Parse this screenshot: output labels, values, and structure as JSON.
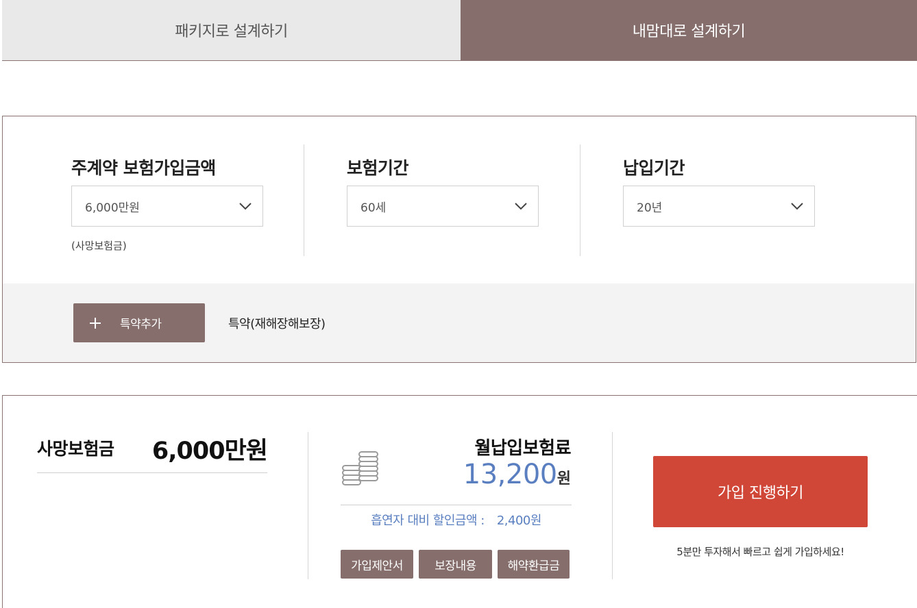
{
  "tabs": [
    {
      "label": "패키지로 설계하기",
      "active": false
    },
    {
      "label": "내맘대로 설계하기",
      "active": true
    }
  ],
  "options": [
    {
      "title": "주계약 보험가입금액",
      "selected": "6,000만원",
      "hint": "(사망보험금)"
    },
    {
      "title": "보험기간",
      "selected": "60세",
      "hint": ""
    },
    {
      "title": "납입기간",
      "selected": "20년",
      "hint": ""
    }
  ],
  "rider": {
    "add_button_label": "특약추가",
    "added_rider": "특약(재해장해보장)"
  },
  "summary": {
    "death_benefit_label": "사망보험금",
    "death_benefit_value": "6,000만원",
    "premium_label": "월납입보험료",
    "premium_value": "13,200",
    "premium_unit": "원",
    "discount_label": "흡연자 대비 할인금액 :",
    "discount_value": "2,400원",
    "doc_buttons": [
      "가입제안서",
      "보장내용",
      "해약환급금"
    ],
    "join_button_label": "가입 진행하기",
    "join_note": "5분만 투자해서 빠르고 쉽게 가입하세요!"
  },
  "colors": {
    "brand": "#856e6c",
    "accent_red": "#d04637",
    "premium_blue": "#5a7fc0",
    "tab_inactive_bg": "#e9e9ea"
  }
}
